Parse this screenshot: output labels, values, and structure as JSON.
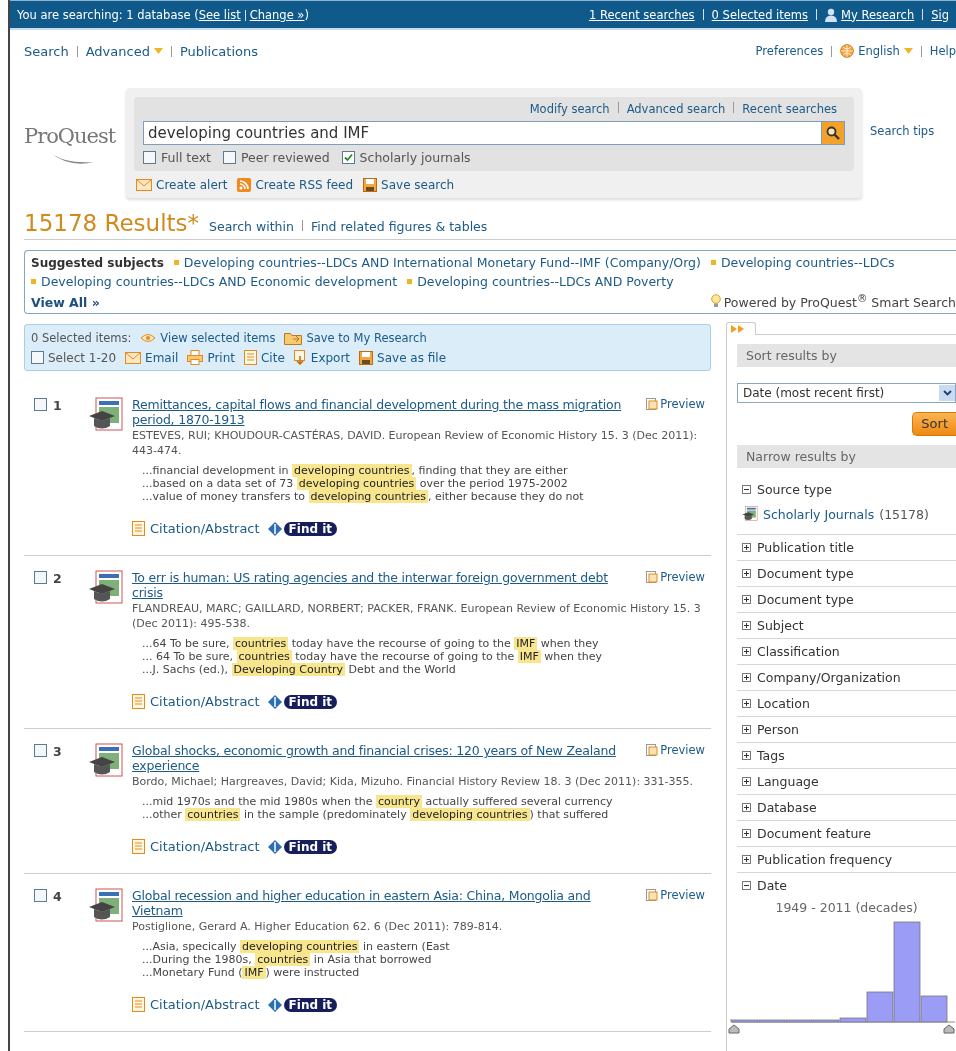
{
  "top_bar": {
    "prefix": "You are searching: 1 database (",
    "see_list": "See list",
    "change": "Change »",
    "suffix": ")",
    "links": [
      {
        "label": "1 Recent searches",
        "kind": "plain"
      },
      {
        "label": "0 Selected items",
        "kind": "plain"
      },
      {
        "label": "My Research",
        "kind": "account"
      },
      {
        "label": "Sig",
        "kind": "plain"
      }
    ]
  },
  "nav": {
    "left": [
      {
        "label": "Search",
        "kind": "link"
      },
      {
        "label": "Advanced",
        "kind": "dropdown"
      },
      {
        "label": "Publications",
        "kind": "link"
      }
    ],
    "right": [
      {
        "label": "Preferences",
        "kind": "link"
      },
      {
        "label": "English",
        "kind": "language"
      },
      {
        "label": "Help",
        "kind": "link"
      }
    ]
  },
  "search": {
    "logo": "ProQuest",
    "links": [
      "Modify search",
      "Advanced search",
      "Recent searches"
    ],
    "query": "developing countries and IMF",
    "filters": [
      {
        "label": "Full text",
        "checked": false
      },
      {
        "label": "Peer reviewed",
        "checked": false
      },
      {
        "label": "Scholarly journals",
        "checked": true
      }
    ],
    "actions": [
      "Create alert",
      "Create RSS feed",
      "Save search"
    ],
    "tips": "Search tips"
  },
  "results": {
    "count": "15178 Results*",
    "links": [
      "Search within",
      "Find related figures & tables"
    ]
  },
  "suggested": {
    "label": "Suggested subjects",
    "subjects": [
      "Developing countries--LDCs AND International Monetary Fund--IMF (Company/Org)",
      "Developing countries--LDCs",
      "Developing countries--LDCs AND Economic development",
      "Developing countries--LDCs AND Poverty"
    ],
    "view_all": "View All »",
    "powered": "Powered by ProQuest$^{®}$ Smart Search"
  },
  "toolbar": {
    "selected": "0 Selected items:",
    "top_actions": [
      "View selected items",
      "Save to My Research"
    ],
    "select_all": {
      "label": "Select 1-20",
      "checked": false
    },
    "actions": [
      "Email",
      "Print",
      "Cite",
      "Export",
      "Save as file"
    ]
  },
  "records": [
    {
      "number": "1",
      "checked": false,
      "title": "Remittances, capital flows and financial development during the mass migration period, 1870-1913",
      "preview": "Preview",
      "meta": "ESTEVES, RUI; KHOUDOUR-CASTÉRAS, DAVID. European Review of Economic History 15. 3  (Dec 2011): 443-474.",
      "snippets": [
        "...financial development in **developing countries**, finding that they are either",
        "...based on a data set of 73 **developing countries** over the period 1975-2002",
        "...value of money transfers to **developing countries**, either because they do not"
      ],
      "citation": "Citation/Abstract",
      "find_it": "Find it"
    },
    {
      "number": "2",
      "checked": false,
      "title": "To err is human: US rating agencies and the interwar foreign government debt crisis",
      "preview": "Preview",
      "meta": "FLANDREAU, MARC; GAILLARD, NORBERT; PACKER, FRANK. European Review of Economic History 15. 3  (Dec 2011): 495-538.",
      "snippets": [
        "...64 To be sure, **countries** today have the recourse of going to the **IMF** when they",
        "... 64 To be sure, **countries** today have the recourse of going to the **IMF** when they",
        "...J. Sachs (ed.), **Developing Country** Debt and the World"
      ],
      "citation": "Citation/Abstract",
      "find_it": "Find it"
    },
    {
      "number": "3",
      "checked": false,
      "title": "Global shocks, economic growth and financial crises: 120 years of New Zealand experience",
      "preview": "Preview",
      "meta": "Bordo, Michael; Hargreaves, David; Kida, Mizuho. Financial History Review 18. 3  (Dec 2011): 331-355.",
      "snippets": [
        "...mid 1970s and the mid 1980s when the **country** actually suffered several currency",
        "...other **countries** in the sample (predominately **developing countries**) that suffered"
      ],
      "citation": "Citation/Abstract",
      "find_it": "Find it"
    },
    {
      "number": "4",
      "checked": false,
      "title": "Global recession and higher education in eastern Asia: China, Mongolia and Vietnam",
      "preview": "Preview",
      "meta": "Postiglione, Gerard A. Higher Education 62. 6  (Dec 2011): 789-814.",
      "snippets": [
        "...Asia, specically **developing countries** in eastern (East",
        "...During the 1980s, **countries** in Asia that borrowed",
        "...Monetary Fund (**IMF**) were instructed"
      ],
      "citation": "Citation/Abstract",
      "find_it": "Find it"
    }
  ],
  "sidebar": {
    "sort_header": "Sort results by",
    "sort_value": "Date (most recent first)",
    "sort_button": "Sort",
    "narrow_header": "Narrow results by",
    "facets": [
      {
        "label": "Source type",
        "expanded": true,
        "children": [
          {
            "label": "Scholarly Journals",
            "count": "(15178)"
          }
        ]
      },
      {
        "label": "Publication title",
        "expanded": false
      },
      {
        "label": "Document type",
        "expanded": false
      },
      {
        "label": "Document type",
        "expanded": false
      },
      {
        "label": "Subject",
        "expanded": false
      },
      {
        "label": "Classification",
        "expanded": false
      },
      {
        "label": "Company/Organization",
        "expanded": false
      },
      {
        "label": "Location",
        "expanded": false
      },
      {
        "label": "Person",
        "expanded": false
      },
      {
        "label": "Tags",
        "expanded": false
      },
      {
        "label": "Language",
        "expanded": false
      },
      {
        "label": "Database",
        "expanded": false
      },
      {
        "label": "Document feature",
        "expanded": false
      },
      {
        "label": "Publication frequency",
        "expanded": false
      },
      {
        "label": "Date",
        "expanded": true,
        "range": "1949 - 2011 (decades)"
      }
    ]
  }
}
